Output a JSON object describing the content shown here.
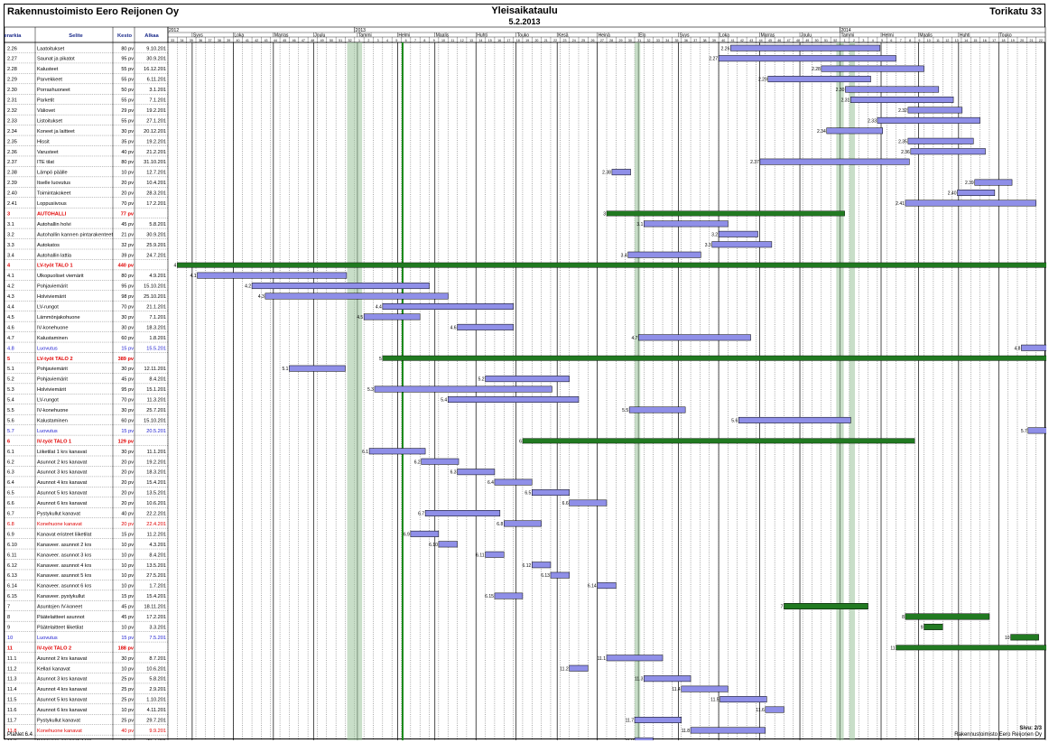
{
  "header": {
    "company": "Rakennustoimisto Eero Reijonen Oy",
    "title": "Yleisaikataulu",
    "date": "5.2.2013",
    "site": "Torikatu 33"
  },
  "columns": {
    "hierarkia": "Hierarkia",
    "selite": "Selite",
    "kesto": "Kesto",
    "alkaa": "Alkaa"
  },
  "footer": {
    "left": "PlaNet 6.4",
    "right": "Rakennustoimisto Eero Reijonen Oy",
    "page": "Sivu: 2/3"
  },
  "colors": {
    "task_bar": "#8f8fe8",
    "summary_bar": "#217a21",
    "summary_text": "#e00000",
    "milestone_text": "#2020d0",
    "today_line": "#1a8a1a"
  },
  "chart_data": {
    "type": "gantt",
    "week_range": "2012 vk 33 – 2014 vk 22",
    "years": [
      "2012",
      "2013",
      "2014"
    ],
    "months": [
      "Syys",
      "Loka",
      "Marras",
      "Joulu",
      "Tammi",
      "Helmi",
      "Maalis",
      "Huhti",
      "Touko",
      "Kesä",
      "Heinä",
      "Elo",
      "Syys",
      "Loka",
      "Marras",
      "Joulu",
      "Tammi",
      "Helmi",
      "Maalis",
      "Huhti",
      "Touko"
    ],
    "today": "5.2.2013",
    "rows": [
      {
        "id": "2.26",
        "name": "Laatoitukset",
        "dur": "80 pv",
        "start": "9.10.201",
        "type": "task"
      },
      {
        "id": "2.27",
        "name": "Saunat ja pikatot",
        "dur": "95 pv",
        "start": "30.9.201",
        "type": "task"
      },
      {
        "id": "2.28",
        "name": "Kalusteet",
        "dur": "55 pv",
        "start": "16.12.201",
        "type": "task"
      },
      {
        "id": "2.29",
        "name": "Parvekkeet",
        "dur": "55 pv",
        "start": "6.11.201",
        "type": "task"
      },
      {
        "id": "2.30",
        "name": "Porrashuoneet",
        "dur": "50 pv",
        "start": "3.1.201",
        "type": "task"
      },
      {
        "id": "2.31",
        "name": "Parketit",
        "dur": "55 pv",
        "start": "7.1.201",
        "type": "task"
      },
      {
        "id": "2.32",
        "name": "Väliovet",
        "dur": "29 pv",
        "start": "19.2.201",
        "type": "task"
      },
      {
        "id": "2.33",
        "name": "Listoitukset",
        "dur": "55 pv",
        "start": "27.1.201",
        "type": "task"
      },
      {
        "id": "2.34",
        "name": "Koneet ja laitteet",
        "dur": "30 pv",
        "start": "20.12.201",
        "type": "task"
      },
      {
        "id": "2.35",
        "name": "Hissit",
        "dur": "35 pv",
        "start": "19.2.201",
        "type": "task"
      },
      {
        "id": "2.36",
        "name": "Varusteet",
        "dur": "40 pv",
        "start": "21.2.201",
        "type": "task"
      },
      {
        "id": "2.37",
        "name": "ITE tilat",
        "dur": "80 pv",
        "start": "31.10.201",
        "type": "task"
      },
      {
        "id": "2.38",
        "name": "Lämpö päälle",
        "dur": "10 pv",
        "start": "12.7.201",
        "type": "task"
      },
      {
        "id": "2.39",
        "name": "Itselle luovutus",
        "dur": "20 pv",
        "start": "10.4.201",
        "type": "task"
      },
      {
        "id": "2.40",
        "name": "Toimintakokeet",
        "dur": "20 pv",
        "start": "28.3.201",
        "type": "task"
      },
      {
        "id": "2.41",
        "name": "Loppusiivous",
        "dur": "70 pv",
        "start": "17.2.201",
        "type": "task"
      },
      {
        "id": "3",
        "name": "AUTOHALLI",
        "dur": "77 pv",
        "start": "",
        "type": "summary"
      },
      {
        "id": "3.1",
        "name": "Autohallin holvi",
        "dur": "45 pv",
        "start": "5.8.201",
        "type": "task"
      },
      {
        "id": "3.2",
        "name": "Autohallin kannen pintarakenteet",
        "dur": "21 pv",
        "start": "30.9.201",
        "type": "task"
      },
      {
        "id": "3.3",
        "name": "Autokatos",
        "dur": "32 pv",
        "start": "25.9.201",
        "type": "task"
      },
      {
        "id": "3.4",
        "name": "Autohallin lattia",
        "dur": "39 pv",
        "start": "24.7.201",
        "type": "task"
      },
      {
        "id": "4",
        "name": "LV-työt TALO 1",
        "dur": "440 pv",
        "start": "",
        "type": "summary"
      },
      {
        "id": "4.1",
        "name": "Ulkopuoliset viemärit",
        "dur": "80 pv",
        "start": "4.9.201",
        "type": "task"
      },
      {
        "id": "4.2",
        "name": "Pohjaviemärit",
        "dur": "95 pv",
        "start": "15.10.201",
        "type": "task"
      },
      {
        "id": "4.3",
        "name": "Holviviemärit",
        "dur": "98 pv",
        "start": "25.10.201",
        "type": "task"
      },
      {
        "id": "4.4",
        "name": "LV-rungot",
        "dur": "70 pv",
        "start": "21.1.201",
        "type": "task"
      },
      {
        "id": "4.5",
        "name": "Lämmönjakohuone",
        "dur": "30 pv",
        "start": "7.1.201",
        "type": "task"
      },
      {
        "id": "4.6",
        "name": "IV-konehuone",
        "dur": "30 pv",
        "start": "18.3.201",
        "type": "task"
      },
      {
        "id": "4.7",
        "name": "Kalustaminen",
        "dur": "60 pv",
        "start": "1.8.201",
        "type": "task"
      },
      {
        "id": "4.8",
        "name": "Luovutus",
        "dur": "15 pv",
        "start": "15.5.201",
        "type": "milestone"
      },
      {
        "id": "5",
        "name": "LV-työt TALO 2",
        "dur": "389 pv",
        "start": "",
        "type": "summary"
      },
      {
        "id": "5.1",
        "name": "Pohjaviemärit",
        "dur": "30 pv",
        "start": "12.11.201",
        "type": "task"
      },
      {
        "id": "5.2",
        "name": "Pohjaviemärit",
        "dur": "45 pv",
        "start": "8.4.201",
        "type": "task"
      },
      {
        "id": "5.3",
        "name": "Holviviemärit",
        "dur": "95 pv",
        "start": "15.1.201",
        "type": "task"
      },
      {
        "id": "5.4",
        "name": "LV-rungot",
        "dur": "70 pv",
        "start": "11.3.201",
        "type": "task"
      },
      {
        "id": "5.5",
        "name": "IV-konehuone",
        "dur": "30 pv",
        "start": "25.7.201",
        "type": "task"
      },
      {
        "id": "5.6",
        "name": "Kalustaminen",
        "dur": "60 pv",
        "start": "15.10.201",
        "type": "task"
      },
      {
        "id": "5.7",
        "name": "Luovutus",
        "dur": "15 pv",
        "start": "20.5.201",
        "type": "milestone"
      },
      {
        "id": "6",
        "name": "IV-työt TALO 1",
        "dur": "129 pv",
        "start": "",
        "type": "summary"
      },
      {
        "id": "6.1",
        "name": "Liiketilat 1 krs kanavat",
        "dur": "30 pv",
        "start": "11.1.201",
        "type": "task"
      },
      {
        "id": "6.2",
        "name": "Asunnot 2 krs kanavat",
        "dur": "20 pv",
        "start": "19.2.201",
        "type": "task"
      },
      {
        "id": "6.3",
        "name": "Asunnot 3 krs kanavat",
        "dur": "20 pv",
        "start": "18.3.201",
        "type": "task"
      },
      {
        "id": "6.4",
        "name": "Asunnot 4 krs kanavat",
        "dur": "20 pv",
        "start": "15.4.201",
        "type": "task"
      },
      {
        "id": "6.5",
        "name": "Asunnot 5 krs kanavat",
        "dur": "20 pv",
        "start": "13.5.201",
        "type": "task"
      },
      {
        "id": "6.6",
        "name": "Asunnot 6 krs kanavat",
        "dur": "20 pv",
        "start": "10.6.201",
        "type": "task"
      },
      {
        "id": "6.7",
        "name": "Pystykullut kanavat",
        "dur": "40 pv",
        "start": "22.2.201",
        "type": "task"
      },
      {
        "id": "6.8",
        "name": "Konehuone kanavat",
        "dur": "20 pv",
        "start": "22.4.201",
        "type": "summary-task"
      },
      {
        "id": "6.9",
        "name": "Kanavat eristeet liiketilat",
        "dur": "15 pv",
        "start": "11.2.201",
        "type": "task"
      },
      {
        "id": "6.10",
        "name": "Kanaveer. asunnot 2 krs",
        "dur": "10 pv",
        "start": "4.3.201",
        "type": "task"
      },
      {
        "id": "6.11",
        "name": "Kanaveer. asunnot 3 krs",
        "dur": "10 pv",
        "start": "8.4.201",
        "type": "task"
      },
      {
        "id": "6.12",
        "name": "Kanaveer. asunnot 4 krs",
        "dur": "10 pv",
        "start": "13.5.201",
        "type": "task"
      },
      {
        "id": "6.13",
        "name": "Kanaveer. asunnot 5 krs",
        "dur": "10 pv",
        "start": "27.5.201",
        "type": "task"
      },
      {
        "id": "6.14",
        "name": "Kanaveer. asunnot 6 krs",
        "dur": "10 pv",
        "start": "1.7.201",
        "type": "task"
      },
      {
        "id": "6.15",
        "name": "Kanaveer. pystykullut",
        "dur": "15 pv",
        "start": "15.4.201",
        "type": "task"
      },
      {
        "id": "7",
        "name": "Asuntojen IV-koneet",
        "dur": "45 pv",
        "start": "18.11.201",
        "type": "task"
      },
      {
        "id": "8",
        "name": "Päätelaitteet asunnot",
        "dur": "45 pv",
        "start": "17.2.201",
        "type": "task"
      },
      {
        "id": "9",
        "name": "Päätelaitteet liiketilat",
        "dur": "10 pv",
        "start": "3.3.201",
        "type": "task"
      },
      {
        "id": "10",
        "name": "Luovutus",
        "dur": "15 pv",
        "start": "7.5.201",
        "type": "milestone"
      },
      {
        "id": "11",
        "name": "IV-työt TALO 2",
        "dur": "188 pv",
        "start": "",
        "type": "summary"
      },
      {
        "id": "11.1",
        "name": "Asunnot 2 krs kanavat",
        "dur": "30 pv",
        "start": "8.7.201",
        "type": "task"
      },
      {
        "id": "11.2",
        "name": "Kellari kanavat",
        "dur": "10 pv",
        "start": "10.6.201",
        "type": "task"
      },
      {
        "id": "11.3",
        "name": "Asunnot 3 krs kanavat",
        "dur": "25 pv",
        "start": "5.8.201",
        "type": "task"
      },
      {
        "id": "11.4",
        "name": "Asunnot 4 krs kanavat",
        "dur": "25 pv",
        "start": "2.9.201",
        "type": "task"
      },
      {
        "id": "11.5",
        "name": "Asunnot 5 krs kanavat",
        "dur": "25 pv",
        "start": "1.10.201",
        "type": "task"
      },
      {
        "id": "11.6",
        "name": "Asunnot 6 krs kanavat",
        "dur": "10 pv",
        "start": "4.11.201",
        "type": "task"
      },
      {
        "id": "11.7",
        "name": "Pystykullut kanavat",
        "dur": "25 pv",
        "start": "29.7.201",
        "type": "task"
      },
      {
        "id": "11.8",
        "name": "Konehuone kanavat",
        "dur": "40 pv",
        "start": "9.9.201",
        "type": "summary-task"
      },
      {
        "id": "11.9",
        "name": "Kanaveer. asunnot 2 krs",
        "dur": "10 pv",
        "start": "29.7.201",
        "type": "task"
      }
    ]
  }
}
